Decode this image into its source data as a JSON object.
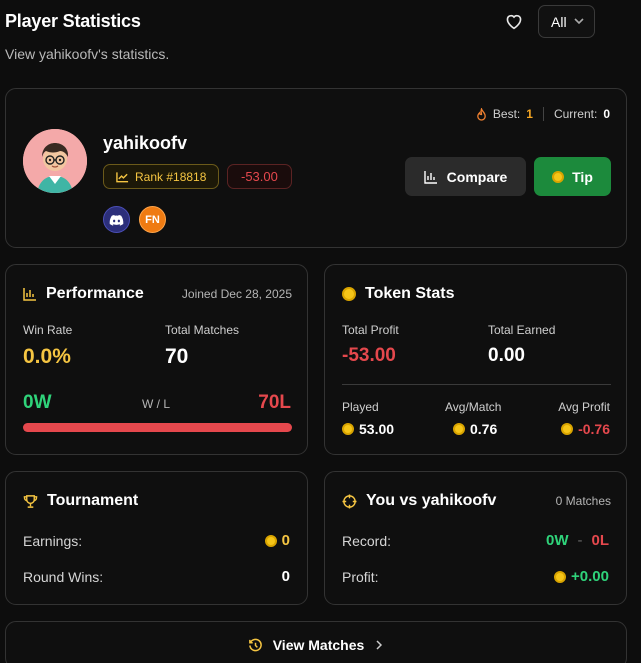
{
  "header": {
    "title": "Player Statistics",
    "subtitle": "View yahikoofv's statistics.",
    "filter_value": "All"
  },
  "profile": {
    "username": "yahikoofv",
    "rank": "Rank #18818",
    "profit": "-53.00",
    "streak_best_label": "Best:",
    "streak_best_value": "1",
    "streak_current_label": "Current:",
    "streak_current_value": "0",
    "compare_label": "Compare",
    "tip_label": "Tip",
    "fn_badge": "FN"
  },
  "performance": {
    "title": "Performance",
    "joined": "Joined Dec 28, 2025",
    "win_rate_label": "Win Rate",
    "win_rate_value": "0.0%",
    "total_matches_label": "Total Matches",
    "total_matches_value": "70",
    "wins": "0W",
    "losses": "70L",
    "wl_label": "W / L",
    "win_fraction": 0
  },
  "token_stats": {
    "title": "Token Stats",
    "total_profit_label": "Total Profit",
    "total_profit_value": "-53.00",
    "total_earned_label": "Total Earned",
    "total_earned_value": "0.00",
    "played_label": "Played",
    "played_value": "53.00",
    "avg_match_label": "Avg/Match",
    "avg_match_value": "0.76",
    "avg_profit_label": "Avg Profit",
    "avg_profit_value": "-0.76"
  },
  "tournament": {
    "title": "Tournament",
    "earnings_label": "Earnings:",
    "earnings_value": "0",
    "round_wins_label": "Round Wins:",
    "round_wins_value": "0"
  },
  "versus": {
    "title": "You vs yahikoofv",
    "matches": "0 Matches",
    "record_label": "Record:",
    "record_wins": "0W",
    "record_sep": "-",
    "record_losses": "0L",
    "profit_label": "Profit:",
    "profit_value": "+0.00"
  },
  "footer": {
    "view_matches_label": "View Matches"
  },
  "colors": {
    "accent_gold": "#f5c542",
    "negative": "#e5484d",
    "positive": "#2fd37a",
    "tip_green": "#1c8a3c"
  }
}
